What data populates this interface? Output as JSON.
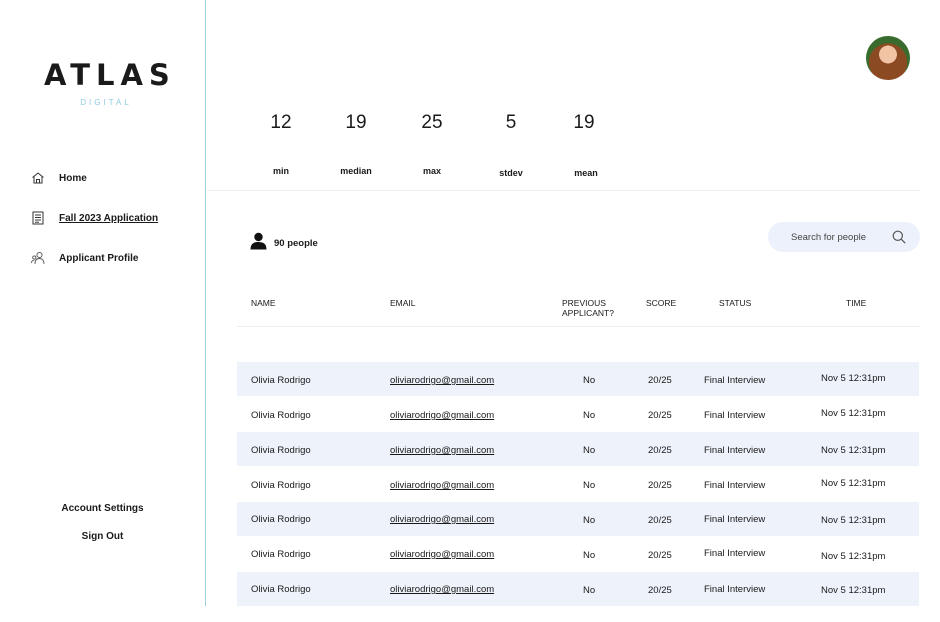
{
  "brand": {
    "name": "ATLAS",
    "sub": "DIGITAL"
  },
  "sidebar": {
    "items": [
      {
        "label": "Home",
        "icon": "home-icon",
        "active": false
      },
      {
        "label": "Fall 2023 Application",
        "icon": "document-icon",
        "active": true
      },
      {
        "label": "Applicant Profile",
        "icon": "profile-icon",
        "active": false
      }
    ],
    "account_settings": "Account Settings",
    "sign_out": "Sign Out"
  },
  "stats": [
    {
      "value": "12",
      "label": "min"
    },
    {
      "value": "19",
      "label": "median"
    },
    {
      "value": "25",
      "label": "max"
    },
    {
      "value": "5",
      "label": "stdev"
    },
    {
      "value": "19",
      "label": "mean"
    }
  ],
  "people_count": "90 people",
  "search": {
    "placeholder": "Search for people"
  },
  "table": {
    "headers": {
      "name": "NAME",
      "email": "EMAIL",
      "previous_line1": "PREVIOUS",
      "previous_line2": "APPLICANT?",
      "score": "SCORE",
      "status": "STATUS",
      "time": "TIME"
    },
    "rows": [
      {
        "name": "Olivia Rodrigo",
        "email": "oliviarodrigo@gmail.com",
        "previous": "No",
        "score": "20/25",
        "status": "Final Interview",
        "time": "Nov 5  12:31pm"
      },
      {
        "name": "Olivia Rodrigo",
        "email": "oliviarodrigo@gmail.com",
        "previous": "No",
        "score": "20/25",
        "status": "Final Interview",
        "time": "Nov 5  12:31pm"
      },
      {
        "name": "Olivia Rodrigo",
        "email": "oliviarodrigo@gmail.com",
        "previous": "No",
        "score": "20/25",
        "status": "Final Interview",
        "time": "Nov 5  12:31pm"
      },
      {
        "name": "Olivia Rodrigo",
        "email": "oliviarodrigo@gmail.com",
        "previous": "No",
        "score": "20/25",
        "status": "Final Interview",
        "time": "Nov 5  12:31pm"
      },
      {
        "name": "Olivia Rodrigo",
        "email": "oliviarodrigo@gmail.com",
        "previous": "No",
        "score": "20/25",
        "status": "Final Interview",
        "time": "Nov 5  12:31pm"
      },
      {
        "name": "Olivia Rodrigo",
        "email": "oliviarodrigo@gmail.com",
        "previous": "No",
        "score": "20/25",
        "status": "Final Interview",
        "time": "Nov 5  12:31pm"
      },
      {
        "name": "Olivia Rodrigo",
        "email": "oliviarodrigo@gmail.com",
        "previous": "No",
        "score": "20/25",
        "status": "Final Interview",
        "time": "Nov 5  12:31pm"
      }
    ]
  },
  "colors": {
    "accent": "#8fcbe0",
    "row_shade": "#eef2fb",
    "search_bg": "#edf1fb"
  },
  "icons": {
    "avatar": "user-avatar",
    "people": "person-icon",
    "search": "search-icon"
  }
}
